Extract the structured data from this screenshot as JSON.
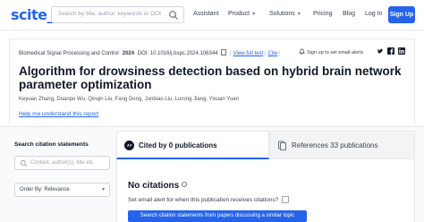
{
  "nav": {
    "logo": "scite_",
    "search_placeholder": "Search by title, author, keywords or DOI",
    "links": [
      "Assistant",
      "Product",
      "Solutions",
      "Pricing",
      "Blog",
      "Log In"
    ],
    "signup": "Sign Up"
  },
  "paper": {
    "journal": "Biomedical Signal Processing and Control",
    "year": "2024",
    "doi": "DOI: 10.1016/j.bspc.2024.106344",
    "view_full_text": "View full text",
    "cite": "Cite",
    "alerts": "Sign up to set email alerts",
    "title": "Algorithm for drowsiness detection based on hybrid brain network parameter optimization",
    "authors": "Keyuan Zhang, Duanpo Wu, Qinqin Liu, Fang Dong, Junbiao Liu, Lurong Jiang, Yixuan Yuan",
    "help": "Help me understand this report"
  },
  "sidebar": {
    "title": "Search citation statements",
    "search_placeholder": "Context, author(s), title etc",
    "order_by": "Order By: Relevance"
  },
  "tabs": {
    "cited": "Cited by 0 publications",
    "references": "References 33 publications"
  },
  "results": {
    "heading": "No citations",
    "alert_question": "Set email alert for when this publication receives citations?",
    "cta": "Search citation statements from papers discussing a similar topic"
  },
  "colors": {
    "accent": "#2563eb"
  }
}
